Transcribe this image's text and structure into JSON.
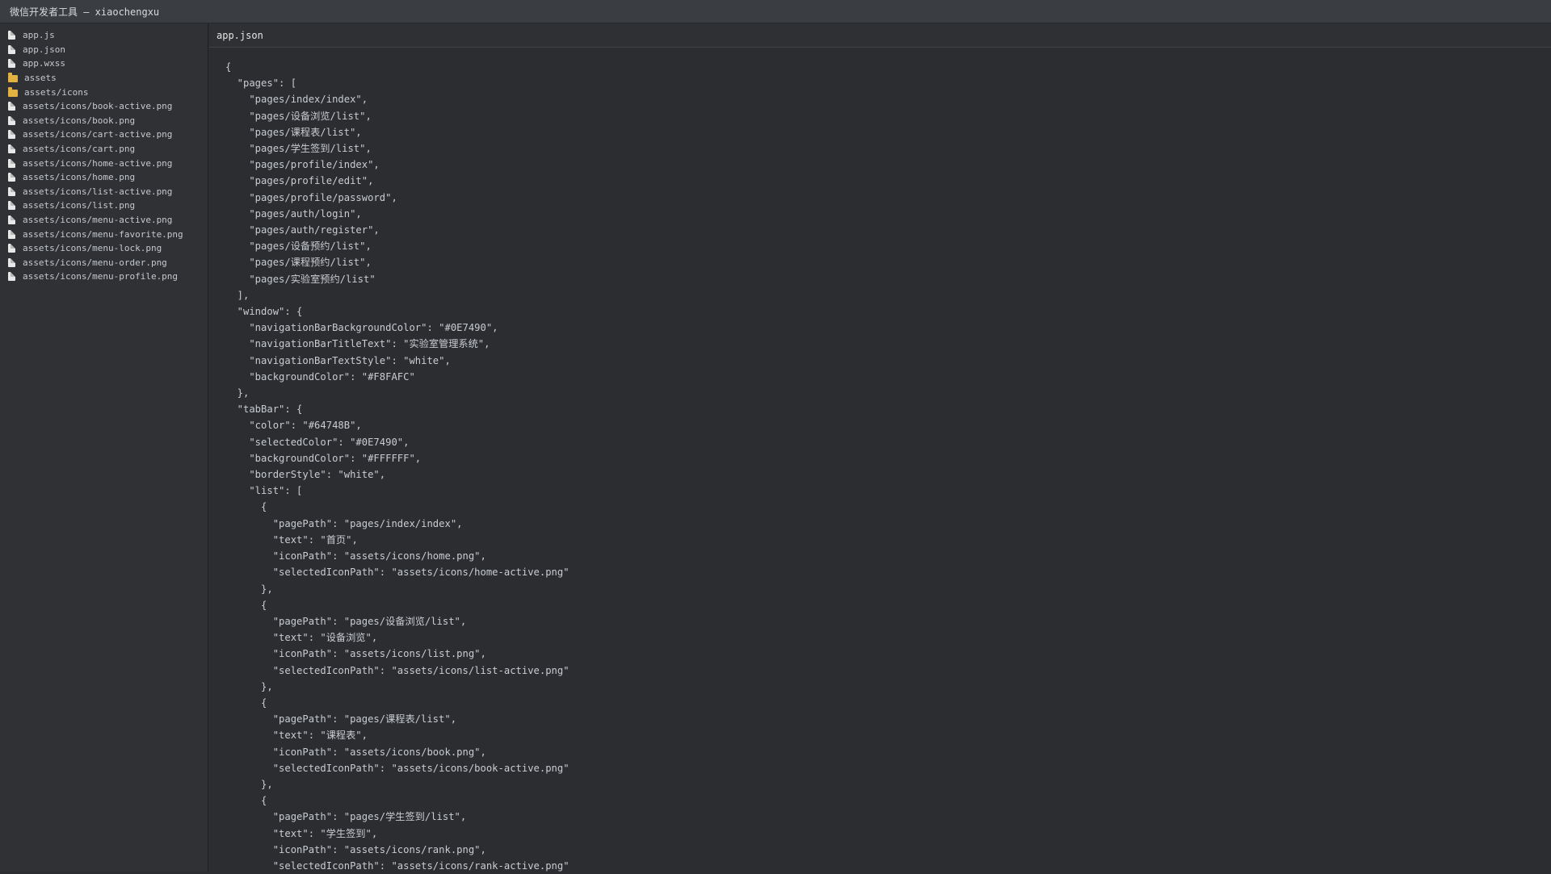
{
  "window": {
    "title": "微信开发者工具 — xiaochengxu"
  },
  "sidebar": {
    "items": [
      {
        "label": "app.js",
        "icon": "file-icon"
      },
      {
        "label": "app.json",
        "icon": "file-icon"
      },
      {
        "label": "app.wxss",
        "icon": "file-icon"
      },
      {
        "label": "assets",
        "icon": "folder-icon"
      },
      {
        "label": "assets/icons",
        "icon": "folder-icon"
      },
      {
        "label": "assets/icons/book-active.png",
        "icon": "file-icon"
      },
      {
        "label": "assets/icons/book.png",
        "icon": "file-icon"
      },
      {
        "label": "assets/icons/cart-active.png",
        "icon": "file-icon"
      },
      {
        "label": "assets/icons/cart.png",
        "icon": "file-icon"
      },
      {
        "label": "assets/icons/home-active.png",
        "icon": "file-icon"
      },
      {
        "label": "assets/icons/home.png",
        "icon": "file-icon"
      },
      {
        "label": "assets/icons/list-active.png",
        "icon": "file-icon"
      },
      {
        "label": "assets/icons/list.png",
        "icon": "file-icon"
      },
      {
        "label": "assets/icons/menu-active.png",
        "icon": "file-icon"
      },
      {
        "label": "assets/icons/menu-favorite.png",
        "icon": "file-icon"
      },
      {
        "label": "assets/icons/menu-lock.png",
        "icon": "file-icon"
      },
      {
        "label": "assets/icons/menu-order.png",
        "icon": "file-icon"
      },
      {
        "label": "assets/icons/menu-profile.png",
        "icon": "file-icon"
      }
    ]
  },
  "editor": {
    "tab_label": "app.json",
    "lines": [
      "{",
      "  \"pages\": [",
      "    \"pages/index/index\",",
      "    \"pages/设备浏览/list\",",
      "    \"pages/课程表/list\",",
      "    \"pages/学生签到/list\",",
      "    \"pages/profile/index\",",
      "    \"pages/profile/edit\",",
      "    \"pages/profile/password\",",
      "    \"pages/auth/login\",",
      "    \"pages/auth/register\",",
      "    \"pages/设备预约/list\",",
      "    \"pages/课程预约/list\",",
      "    \"pages/实验室预约/list\"",
      "  ],",
      "  \"window\": {",
      "    \"navigationBarBackgroundColor\": \"#0E7490\",",
      "    \"navigationBarTitleText\": \"实验室管理系统\",",
      "    \"navigationBarTextStyle\": \"white\",",
      "    \"backgroundColor\": \"#F8FAFC\"",
      "  },",
      "  \"tabBar\": {",
      "    \"color\": \"#64748B\",",
      "    \"selectedColor\": \"#0E7490\",",
      "    \"backgroundColor\": \"#FFFFFF\",",
      "    \"borderStyle\": \"white\",",
      "    \"list\": [",
      "      {",
      "        \"pagePath\": \"pages/index/index\",",
      "        \"text\": \"首页\",",
      "        \"iconPath\": \"assets/icons/home.png\",",
      "        \"selectedIconPath\": \"assets/icons/home-active.png\"",
      "      },",
      "      {",
      "        \"pagePath\": \"pages/设备浏览/list\",",
      "        \"text\": \"设备浏览\",",
      "        \"iconPath\": \"assets/icons/list.png\",",
      "        \"selectedIconPath\": \"assets/icons/list-active.png\"",
      "      },",
      "      {",
      "        \"pagePath\": \"pages/课程表/list\",",
      "        \"text\": \"课程表\",",
      "        \"iconPath\": \"assets/icons/book.png\",",
      "        \"selectedIconPath\": \"assets/icons/book-active.png\"",
      "      },",
      "      {",
      "        \"pagePath\": \"pages/学生签到/list\",",
      "        \"text\": \"学生签到\",",
      "        \"iconPath\": \"assets/icons/rank.png\",",
      "        \"selectedIconPath\": \"assets/icons/rank-active.png\""
    ]
  }
}
